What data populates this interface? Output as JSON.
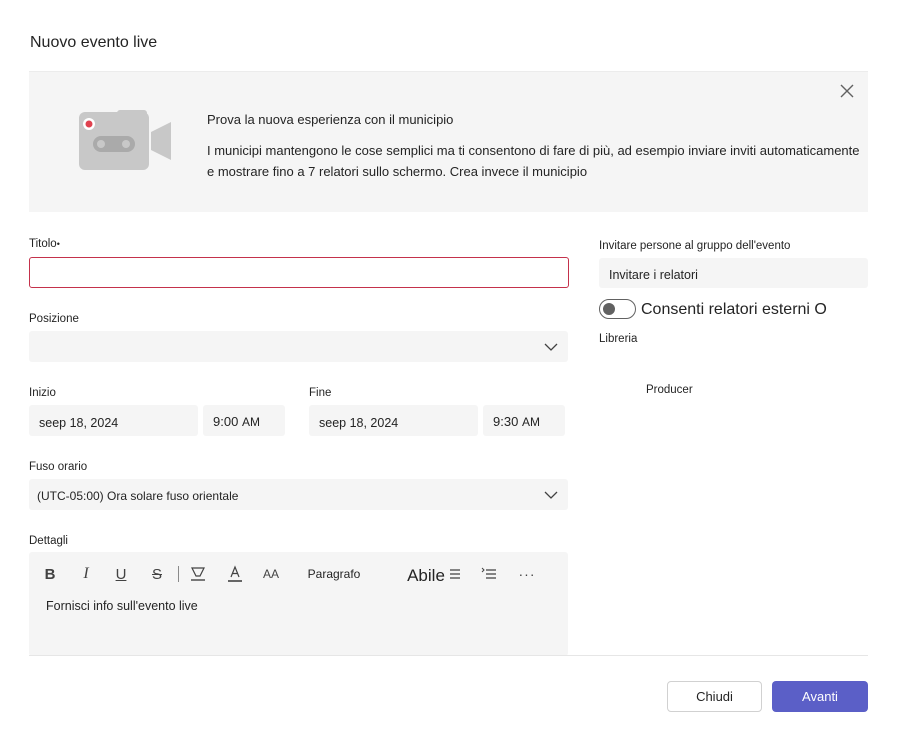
{
  "dialog": {
    "title": "Nuovo evento live"
  },
  "banner": {
    "heading": "Prova la nuova esperienza con il municipio",
    "body": "I municipi mantengono le cose semplici ma ti consentono di fare di più, ad esempio inviare inviti automaticamente e mostrare fino a 7 relatori sullo schermo. Crea invece il municipio",
    "icon": "video-camera-icon",
    "close_icon": "close-icon"
  },
  "form": {
    "title_label": "Titolo",
    "title_required_mark": "•",
    "title_value": "",
    "location_label": "Posizione",
    "location_value": "",
    "start_label": "Inizio",
    "start_date": "seep 18, 2024",
    "start_time": "9:00",
    "start_ampm": "AM",
    "end_label": "Fine",
    "end_date": "seep 18, 2024",
    "end_time": "9:30",
    "end_ampm": "AM",
    "timezone_label": "Fuso orario",
    "timezone_value": "(UTC-05:00) Ora solare fuso orientale",
    "details_label": "Dettagli",
    "details_placeholder": "Fornisci info sull'evento live"
  },
  "toolbar": {
    "bold": "B",
    "italic": "I",
    "underline": "U",
    "strikethrough": "S",
    "font_size": "AA",
    "paragraph": "Paragrafo",
    "abile": "Abile",
    "more": "···"
  },
  "right_panel": {
    "invite_label": "Invitare persone al gruppo dell'evento",
    "invite_value": "Invitare i relatori",
    "external_toggle_label": "Consenti relatori esterni O",
    "external_toggle_on": false,
    "library_label": "Libreria",
    "producer_label": "Producer"
  },
  "footer": {
    "cancel_label": "Chiudi",
    "next_label": "Avanti"
  },
  "colors": {
    "accent": "#5b5fc7",
    "error_border": "#c4314b",
    "field_bg": "#f5f5f5",
    "camera_icon": "#c8c8c8",
    "camera_dot": "#e0424f"
  }
}
